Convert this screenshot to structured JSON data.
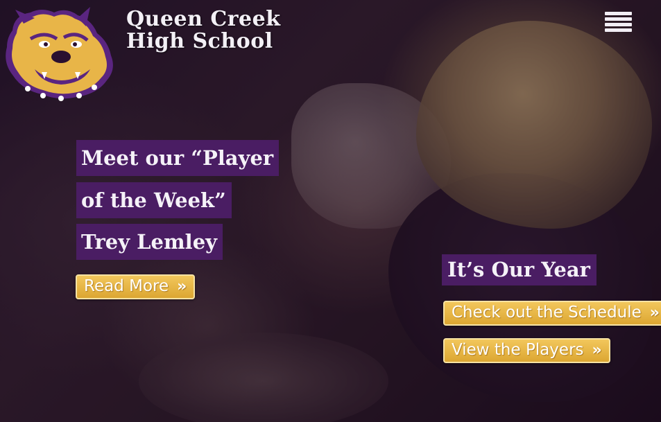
{
  "header": {
    "school_name_line1": "Queen Creek",
    "school_name_line2": "High School",
    "logo_icon": "bulldog-logo-icon",
    "menu_icon": "hamburger-menu-icon"
  },
  "feature_left": {
    "headline_line1": "Meet our “Player",
    "headline_line2": "of the Week”",
    "headline_line3": "Trey Lemley",
    "read_more_label": "Read More",
    "chevron_icon": "double-chevron-right-icon"
  },
  "feature_right": {
    "headline": "It’s Our Year",
    "schedule_label": "Check out the Schedule",
    "players_label": "View the Players",
    "chevron_icon": "double-chevron-right-icon"
  },
  "colors": {
    "brand_purple": "#4a1d63",
    "brand_gold": "#e8b548",
    "text_light": "#f5f2f8"
  }
}
